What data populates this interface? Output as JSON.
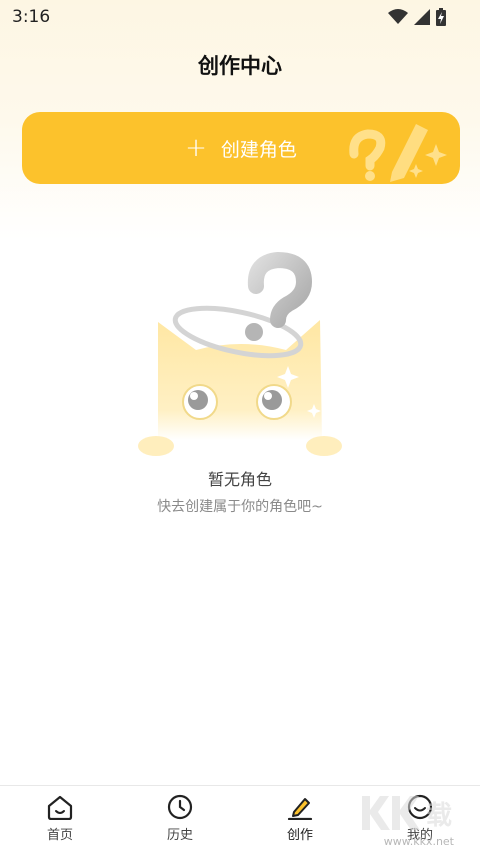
{
  "status": {
    "time": "3:16"
  },
  "header": {
    "title": "创作中心"
  },
  "create_button": {
    "label": "创建角色"
  },
  "empty_state": {
    "title": "暂无角色",
    "subtitle": "快去创建属于你的角色吧~"
  },
  "tabbar": {
    "items": [
      {
        "label": "首页",
        "icon": "home-icon"
      },
      {
        "label": "历史",
        "icon": "clock-icon"
      },
      {
        "label": "创作",
        "icon": "pencil-icon",
        "active": true
      },
      {
        "label": "我的",
        "icon": "smile-icon"
      }
    ]
  },
  "watermark": {
    "text": "www.kkx.net"
  },
  "colors": {
    "accent": "#fcc22c",
    "background_top": "#fdf6e3"
  }
}
